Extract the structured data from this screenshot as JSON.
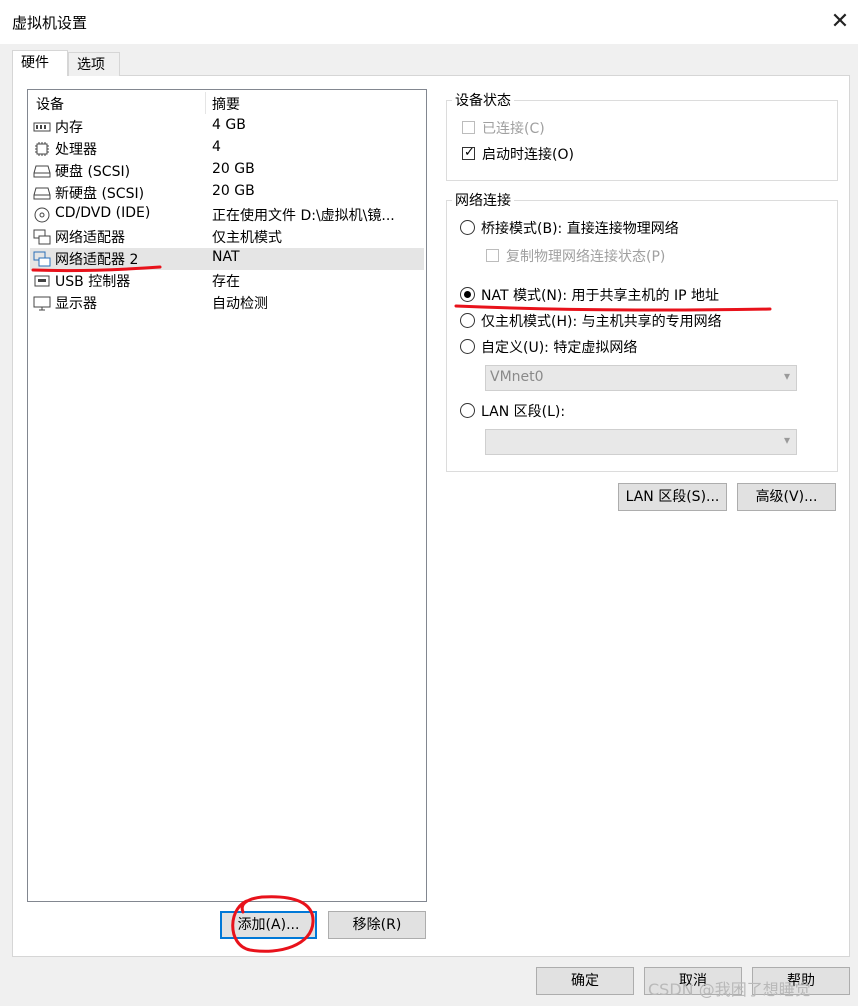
{
  "window": {
    "title": "虚拟机设置",
    "close_icon": "close-icon"
  },
  "tabs": [
    {
      "label": "硬件"
    },
    {
      "label": "选项"
    }
  ],
  "device_list": {
    "columns": {
      "device": "设备",
      "summary": "摘要"
    },
    "rows": [
      {
        "name": "内存",
        "summary": "4 GB",
        "icon": "memory-icon"
      },
      {
        "name": "处理器",
        "summary": "4",
        "icon": "processor-icon"
      },
      {
        "name": "硬盘 (SCSI)",
        "summary": "20 GB",
        "icon": "disk-icon"
      },
      {
        "name": "新硬盘 (SCSI)",
        "summary": "20 GB",
        "icon": "disk-icon"
      },
      {
        "name": "CD/DVD (IDE)",
        "summary": "正在使用文件 D:\\虚拟机\\镜...",
        "icon": "cdrom-icon"
      },
      {
        "name": "网络适配器",
        "summary": "仅主机模式",
        "icon": "network-icon"
      },
      {
        "name": "网络适配器 2",
        "summary": "NAT",
        "icon": "network-icon",
        "selected": true
      },
      {
        "name": "USB 控制器",
        "summary": "存在",
        "icon": "usb-icon"
      },
      {
        "name": "显示器",
        "summary": "自动检测",
        "icon": "monitor-icon"
      }
    ]
  },
  "list_buttons": {
    "add": "添加(A)...",
    "remove": "移除(R)"
  },
  "device_status": {
    "title": "设备状态",
    "connected": {
      "label": "已连接(C)",
      "checked": false,
      "disabled": true
    },
    "connect_on_start": {
      "label": "启动时连接(O)",
      "checked": true
    }
  },
  "network": {
    "title": "网络连接",
    "bridged": "桥接模式(B): 直接连接物理网络",
    "replicate": "复制物理网络连接状态(P)",
    "nat": "NAT 模式(N): 用于共享主机的 IP 地址",
    "host_only": "仅主机模式(H): 与主机共享的专用网络",
    "custom": "自定义(U): 特定虚拟网络",
    "custom_value": "VMnet0",
    "lan": "LAN 区段(L):",
    "lan_value": "",
    "selected": "nat"
  },
  "panel_buttons": {
    "lan_segments": "LAN 区段(S)...",
    "advanced": "高级(V)..."
  },
  "footer": {
    "ok": "确定",
    "cancel": "取消",
    "help": "帮助"
  },
  "watermark": "CSDN @我困了想睡觉",
  "colors": {
    "annotation": "#e8121b",
    "focus": "#0078d7",
    "selection": "#e5e5e5"
  }
}
